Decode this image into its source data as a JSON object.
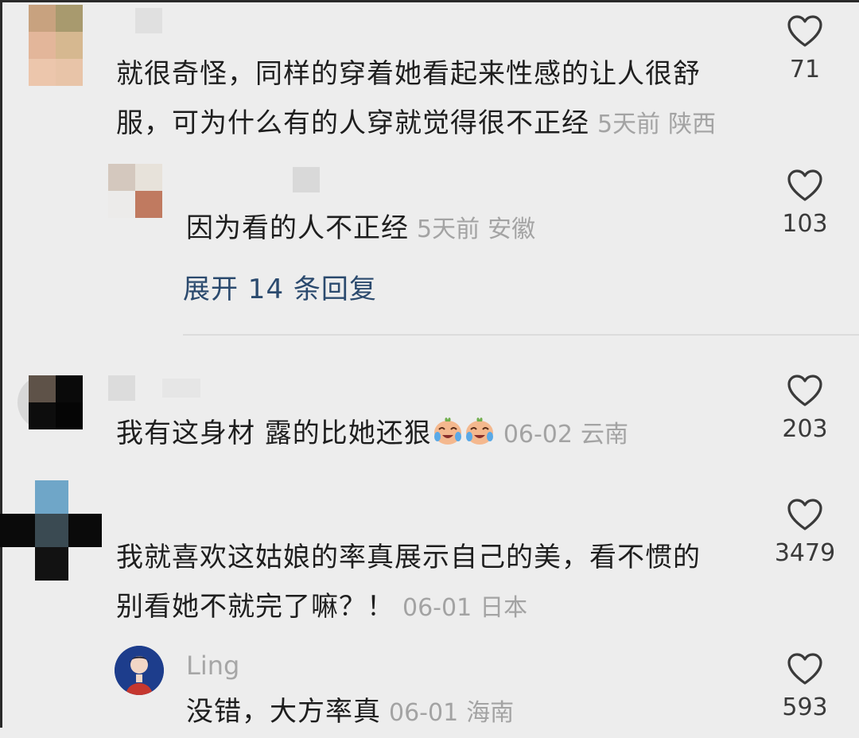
{
  "comments": [
    {
      "text": "就很奇怪，同样的穿着她看起来性感的让人很舒",
      "text_line2": "服，可为什么有的人穿就觉得很不正经",
      "time": "5天前",
      "location": "陕西",
      "likes": "71",
      "reply": {
        "text": "因为看的人不正经",
        "time": "5天前",
        "location": "安徽",
        "likes": "103"
      },
      "expand_label": "展开 14 条回复"
    },
    {
      "text": "我有这身材 露的比她还狠",
      "time": "06-02",
      "location": "云南",
      "likes": "203",
      "emoji_name": "crying-laughing-face-icon"
    },
    {
      "text": "我就喜欢这姑娘的率真展示自己的美，看不惯的",
      "text_line2": "别看她不就完了嘛？！",
      "time": "06-01",
      "location": "日本",
      "likes": "3479",
      "reply": {
        "username": "Ling",
        "text": "没错，大方率真",
        "time": "06-01",
        "location": "海南",
        "likes": "593"
      }
    }
  ],
  "colors": {
    "background": "#ededed",
    "link": "#2b4a6e",
    "meta": "#a3a3a3",
    "text": "#1e1e1e"
  },
  "icons": {
    "like": "heart-outline-icon"
  }
}
